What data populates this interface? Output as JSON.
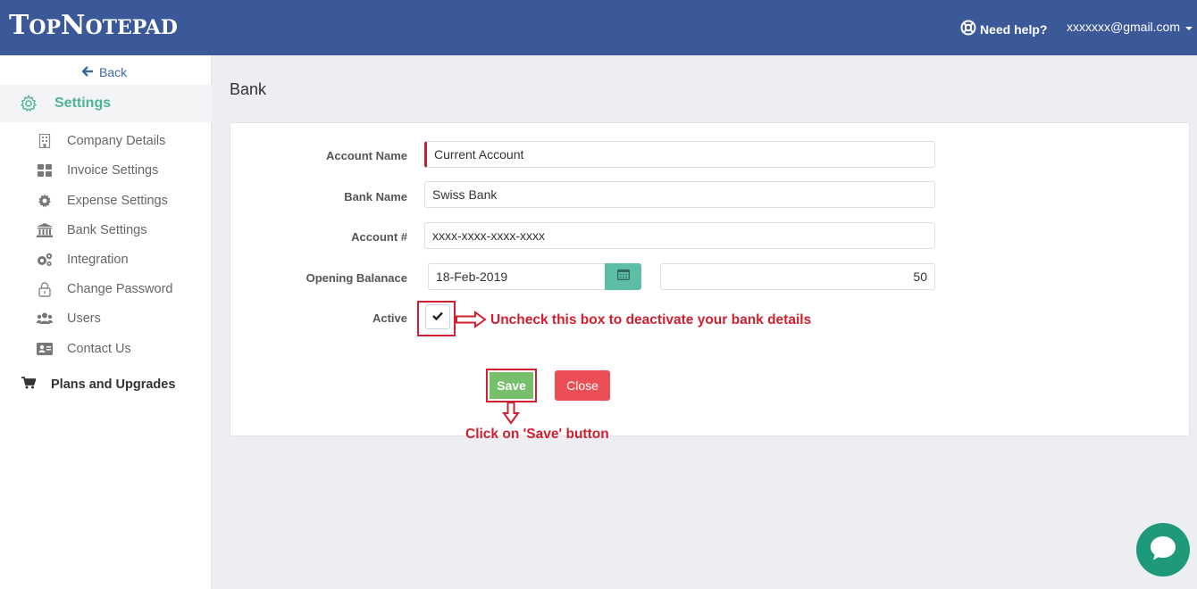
{
  "header": {
    "logo_big1": "T",
    "logo_small1": "OP",
    "logo_big2": "N",
    "logo_small2": "OTEPAD",
    "help_label": "Need help?",
    "user_email": "xxxxxxx@gmail.com"
  },
  "sidebar": {
    "back_label": "Back",
    "settings_label": "Settings",
    "items": [
      {
        "label": "Company Details",
        "icon": "building-icon"
      },
      {
        "label": "Invoice Settings",
        "icon": "grid-icon"
      },
      {
        "label": "Expense Settings",
        "icon": "gear-icon"
      },
      {
        "label": "Bank Settings",
        "icon": "bank-icon"
      },
      {
        "label": "Integration",
        "icon": "gears-icon"
      },
      {
        "label": "Change Password",
        "icon": "lock-icon"
      },
      {
        "label": "Users",
        "icon": "users-icon"
      },
      {
        "label": "Contact Us",
        "icon": "contact-card-icon"
      }
    ],
    "plans_label": "Plans and Upgrades"
  },
  "page": {
    "title": "Bank"
  },
  "form": {
    "account_name_label": "Account Name",
    "account_name_value": "Current Account",
    "bank_name_label": "Bank Name",
    "bank_name_value": "Swiss Bank",
    "account_no_label": "Account #",
    "account_no_value": "xxxx-xxxx-xxxx-xxxx",
    "opening_balance_label": "Opening Balanace",
    "opening_date_value": "18-Feb-2019",
    "opening_amount_value": "50",
    "active_label": "Active",
    "active_checked": true,
    "save_label": "Save",
    "close_label": "Close"
  },
  "annotations": {
    "checkbox_note": "Uncheck this box to deactivate your bank details",
    "save_note": "Click on 'Save' button"
  },
  "colors": {
    "header_bg": "#3b5998",
    "accent_green": "#4fb39a",
    "save_green": "#76c06b",
    "close_red": "#eb4e55",
    "annotation_red": "#d0202f"
  }
}
